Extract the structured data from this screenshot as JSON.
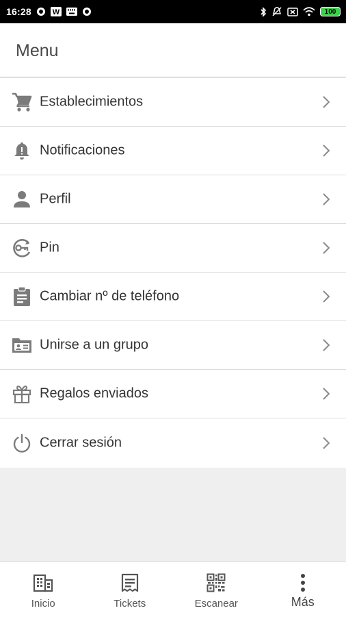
{
  "status_bar": {
    "time": "16:28",
    "battery": "100",
    "left_icons": [
      "circle-notification-icon",
      "app-w-icon",
      "keyboard-icon",
      "circle-notification-icon"
    ],
    "right_icons": [
      "bluetooth-icon",
      "do-not-disturb-icon",
      "sim-icon",
      "wifi-icon",
      "battery-icon"
    ]
  },
  "header": {
    "title": "Menu"
  },
  "menu": {
    "items": [
      {
        "label": "Establecimientos",
        "icon": "cart-icon"
      },
      {
        "label": "Notificaciones",
        "icon": "bell-icon"
      },
      {
        "label": "Perfil",
        "icon": "person-icon"
      },
      {
        "label": "Pin",
        "icon": "key-icon"
      },
      {
        "label": "Cambiar nº de teléfono",
        "icon": "clipboard-icon"
      },
      {
        "label": "Unirse a un grupo",
        "icon": "id-card-icon"
      },
      {
        "label": "Regalos enviados",
        "icon": "gift-icon"
      },
      {
        "label": "Cerrar sesión",
        "icon": "power-icon"
      }
    ]
  },
  "bottom_nav": {
    "tabs": [
      {
        "label": "Inicio",
        "icon": "building-icon"
      },
      {
        "label": "Tickets",
        "icon": "receipt-icon"
      },
      {
        "label": "Escanear",
        "icon": "qr-code-icon"
      },
      {
        "label": "Más",
        "icon": "more-vertical-icon",
        "active": true
      }
    ]
  },
  "colors": {
    "icon": "#7b7b7b",
    "text": "#333333",
    "divider": "#dcdcdc",
    "background": "#efefef",
    "battery": "#3ad24a"
  }
}
